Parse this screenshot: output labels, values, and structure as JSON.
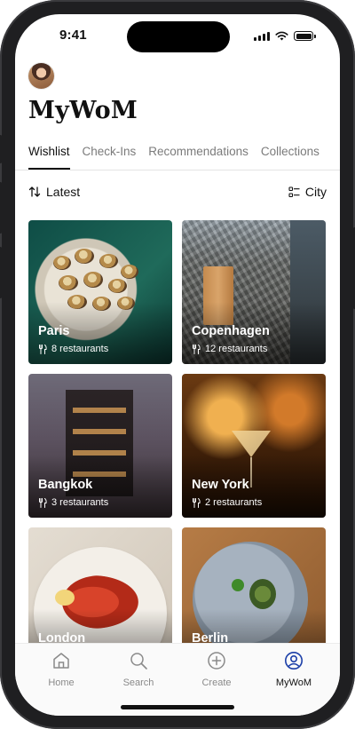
{
  "status_bar": {
    "time": "9:41"
  },
  "header": {
    "title": "MyWoM"
  },
  "tabs": [
    {
      "label": "Wishlist",
      "active": true
    },
    {
      "label": "Check-Ins",
      "active": false
    },
    {
      "label": "Recommendations",
      "active": false
    },
    {
      "label": "Collections",
      "active": false
    }
  ],
  "sort": {
    "label": "Latest",
    "icon": "sort-arrows-icon"
  },
  "filter": {
    "label": "City",
    "icon": "list-filter-icon"
  },
  "cards": [
    {
      "city": "Paris",
      "count": "8 restaurants",
      "image": "clams-dish"
    },
    {
      "city": "Copenhagen",
      "count": "12 restaurants",
      "image": "restaurant-facade"
    },
    {
      "city": "Bangkok",
      "count": "3 restaurants",
      "image": "tower-building"
    },
    {
      "city": "New York",
      "count": "2 restaurants",
      "image": "cocktail-pour"
    },
    {
      "city": "London",
      "count": "",
      "image": "prawns-dish"
    },
    {
      "city": "Berlin",
      "count": "",
      "image": "plated-dish"
    }
  ],
  "bottom_nav": [
    {
      "label": "Home",
      "icon": "home-icon",
      "active": false
    },
    {
      "label": "Search",
      "icon": "search-icon",
      "active": false
    },
    {
      "label": "Create",
      "icon": "plus-circle-icon",
      "active": false
    },
    {
      "label": "MyWoM",
      "icon": "profile-icon",
      "active": true
    }
  ],
  "colors": {
    "accent": "#111111",
    "inactive": "#8a8a8a",
    "nav_bg": "#fafafa"
  }
}
